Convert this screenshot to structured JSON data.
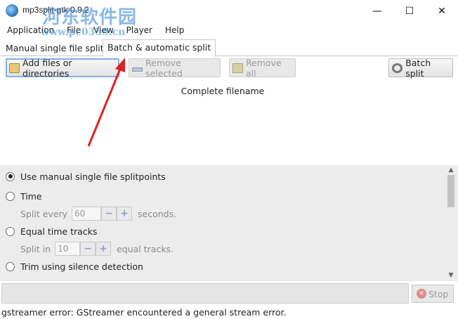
{
  "window": {
    "title": "mp3split-gtk 0.9.2",
    "minimize": "—",
    "maximize": "☐",
    "close": "✕"
  },
  "watermark": {
    "text": "河东软件园",
    "url": "www.pc0359.cn"
  },
  "menu": [
    "Application",
    "File",
    "View",
    "Player",
    "Help"
  ],
  "tabs": [
    {
      "label": "Manual single file split",
      "active": false
    },
    {
      "label": "Batch & automatic split",
      "active": true
    }
  ],
  "toolbar": {
    "add_label": "Add files or directories",
    "remove_selected_label": "Remove selected",
    "remove_all_label": "Remove all",
    "batch_split_label": "Batch split"
  },
  "filelist": {
    "column_header": "Complete filename"
  },
  "options": {
    "manual": "Use manual single file splitpoints",
    "time": "Time",
    "split_every_label": "Split every",
    "split_every_value": "60",
    "seconds_label": "seconds.",
    "equal_tracks": "Equal time tracks",
    "split_in_label": "Split in",
    "split_in_value": "10",
    "equal_tracks_after": "equal tracks.",
    "trim_silence": "Trim using silence detection",
    "spin_minus": "−",
    "spin_plus": "+"
  },
  "stop_label": "Stop",
  "status": "gstreamer error: GStreamer encountered a general stream error."
}
